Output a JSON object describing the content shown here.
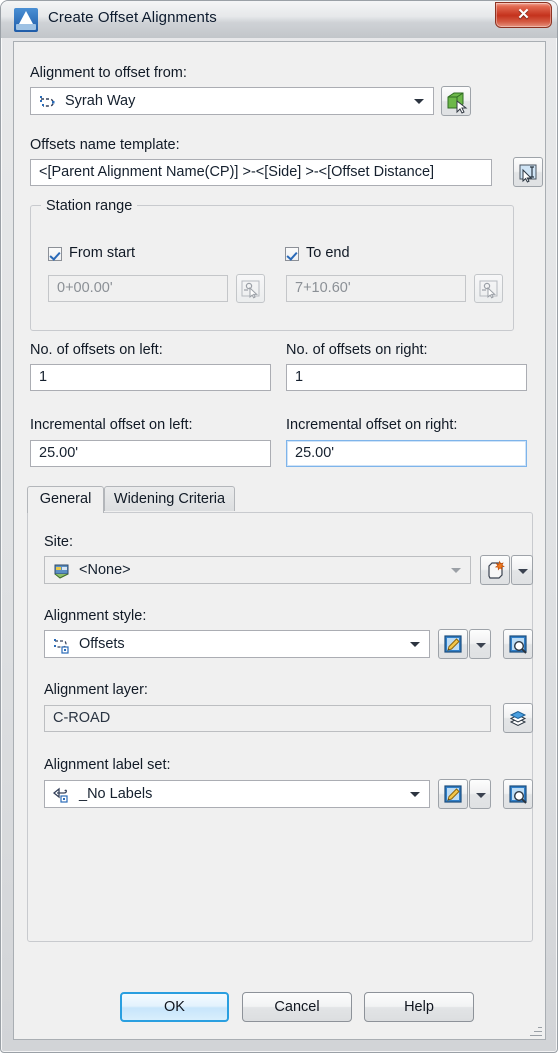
{
  "window": {
    "title": "Create Offset Alignments",
    "app_icon": "autodesk-a-icon",
    "close_label": "✕"
  },
  "form": {
    "alignment_to_offset_from": {
      "label": "Alignment to offset from:",
      "value": "Syrah Way",
      "icon": "alignment-icon",
      "picker_button_icon": "pick-object-in-drawing-icon"
    },
    "offsets_name_template": {
      "label": "Offsets name template:",
      "value": "<[Parent Alignment Name(CP)] >-<[Side] >-<[Offset Distance]",
      "edit_button_icon": "name-template-edit-icon"
    },
    "station_range": {
      "title": "Station range",
      "from_start": {
        "label": "From start",
        "checked": true
      },
      "to_end": {
        "label": "To end",
        "checked": true
      },
      "start_station": {
        "value": "0+00.00'",
        "disabled": true
      },
      "end_station": {
        "value": "7+10.60'",
        "disabled": true
      },
      "pick_start_icon": "pick-station-icon",
      "pick_end_icon": "pick-station-icon"
    },
    "offsets_left": {
      "label": "No. of offsets on left:",
      "value": "1"
    },
    "offsets_right": {
      "label": "No. of offsets on right:",
      "value": "1"
    },
    "increment_left": {
      "label": "Incremental offset on left:",
      "value": "25.00'"
    },
    "increment_right": {
      "label": "Incremental offset on right:",
      "value": "25.00'",
      "focused": true
    }
  },
  "tabs": [
    {
      "label": "General",
      "active": true
    },
    {
      "label": "Widening Criteria",
      "active": false
    }
  ],
  "general_tab": {
    "site": {
      "label": "Site:",
      "value": "<None>",
      "icon": "site-icon",
      "new_button_icon": "new-site-icon",
      "dropdown_icon": "chevron-down-icon"
    },
    "alignment_style": {
      "label": "Alignment style:",
      "value": "Offsets",
      "icon": "alignment-style-icon",
      "edit_button_icon": "edit-pencil-icon",
      "edit_dropdown_icon": "chevron-down-icon",
      "preview_button_icon": "preview-magnifier-icon"
    },
    "alignment_layer": {
      "label": "Alignment layer:",
      "value": "C-ROAD",
      "layer_button_icon": "layers-icon"
    },
    "alignment_label_set": {
      "label": "Alignment label set:",
      "value": "_No Labels",
      "icon": "label-set-icon",
      "edit_button_icon": "edit-pencil-icon",
      "edit_dropdown_icon": "chevron-down-icon",
      "preview_button_icon": "preview-magnifier-icon"
    }
  },
  "footer": {
    "ok": "OK",
    "cancel": "Cancel",
    "help": "Help"
  },
  "colors": {
    "accent_blue": "#2a9fe0",
    "titlebar_text": "#0d1b2e",
    "close_red": "#c4321d",
    "field_border": "#abadb3",
    "panel_bg": "#f0f0f0"
  }
}
